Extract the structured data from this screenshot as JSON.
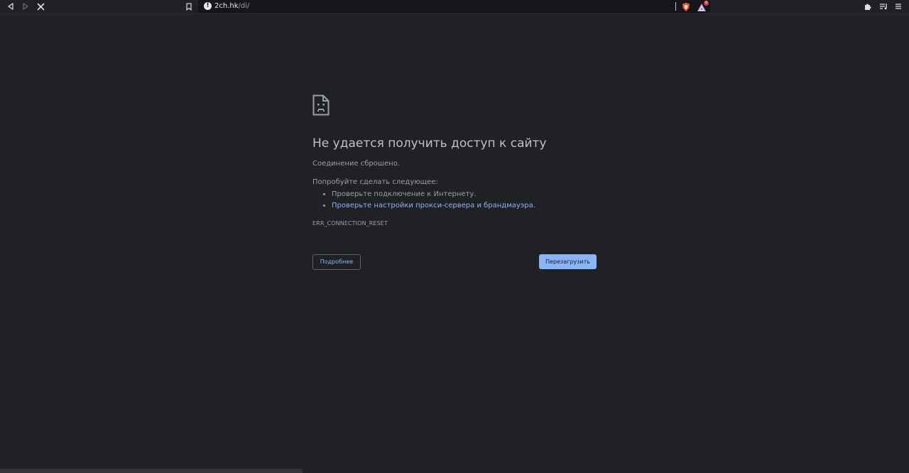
{
  "toolbar": {
    "back_icon": "back-arrow-icon",
    "forward_icon": "forward-arrow-icon",
    "stop_icon": "close-icon",
    "bookmark_icon": "bookmark-icon",
    "extensions_icon": "puzzle-icon",
    "playlist_icon": "playlist-icon",
    "menu_icon": "hamburger-menu-icon"
  },
  "omnibox": {
    "info_icon": "info-icon",
    "info_glyph": "!",
    "host": "2ch.hk",
    "path": "/di/",
    "shield_icon": "brave-shield-icon",
    "rewards_icon": "brave-rewards-icon",
    "rewards_badge": "0"
  },
  "error": {
    "icon": "sad-page-icon",
    "title": "Не удается получить доступ к сайту",
    "summary": "Соединение сброшено.",
    "suggestions_heading": "Попробуйте сделать следующее:",
    "suggestions": [
      "Проверьте подключение к Интернету.",
      "Проверьте настройки прокси-сервера и брандмауэра"
    ],
    "suggestion_suffix": ".",
    "code": "ERR_CONNECTION_RESET",
    "details_button": "Подробнее",
    "reload_button": "Перезагрузить"
  },
  "colors": {
    "background": "#202124",
    "text": "#9aa0a6",
    "title": "#bdc1c6",
    "link": "#8ab4f8",
    "primary_button": "#8ab4f8"
  }
}
